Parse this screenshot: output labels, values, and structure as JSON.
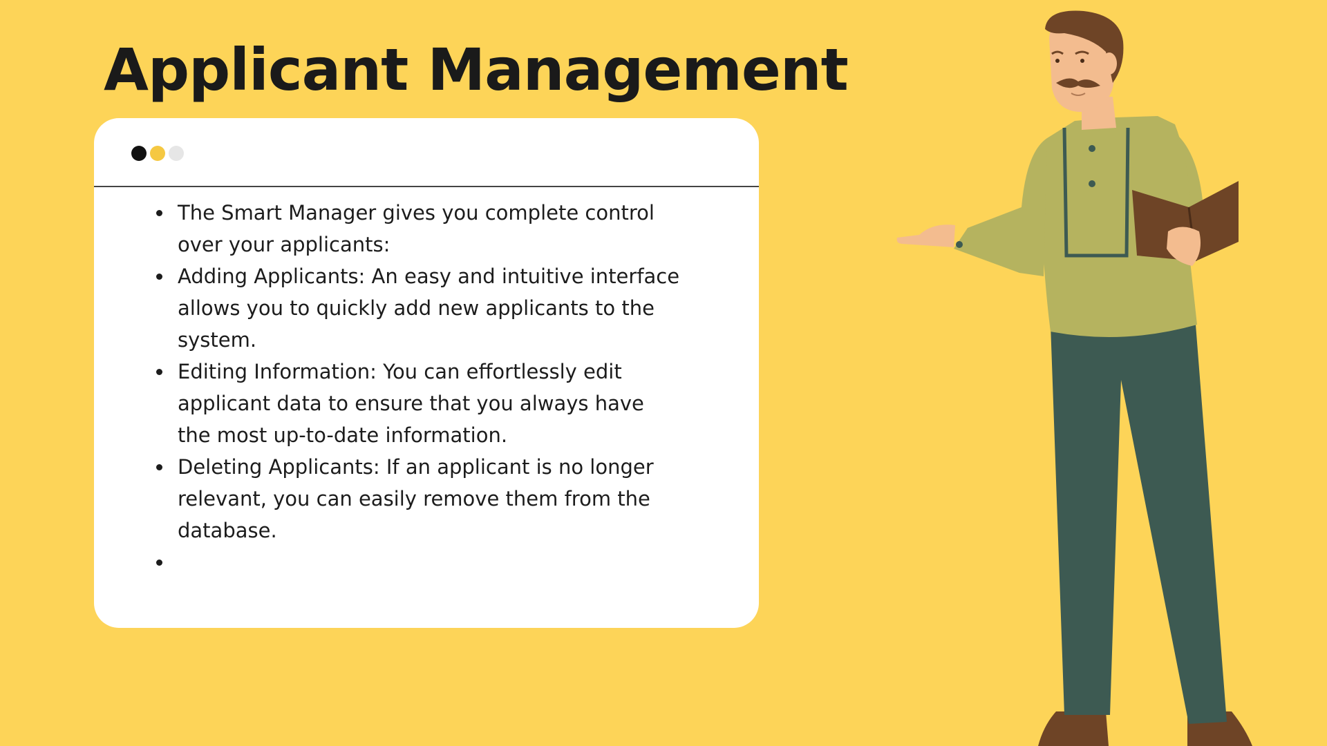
{
  "slide": {
    "title": "Applicant Management",
    "bullets": [
      "The Smart Manager gives you complete control over your applicants:",
      "Adding Applicants: An easy and intuitive interface allows you to quickly add new applicants to the system.",
      "Editing Information: You can effortlessly edit applicant data to ensure that you always have the most up-to-date information.",
      "Deleting Applicants: If an applicant is no longer relevant, you can easily remove them from the database.",
      ""
    ]
  },
  "colors": {
    "background": "#FDD458",
    "card": "#FFFFFF",
    "dot_dark": "#111111",
    "dot_yellow": "#F5C842",
    "dot_light": "#E6E6E6",
    "shirt": "#B5B35F",
    "pants": "#3D5A52",
    "hair": "#6E4426",
    "skin": "#F3BC8F",
    "book": "#6E4426"
  },
  "icons": [
    "window-dots-icon",
    "presenter-illustration"
  ]
}
